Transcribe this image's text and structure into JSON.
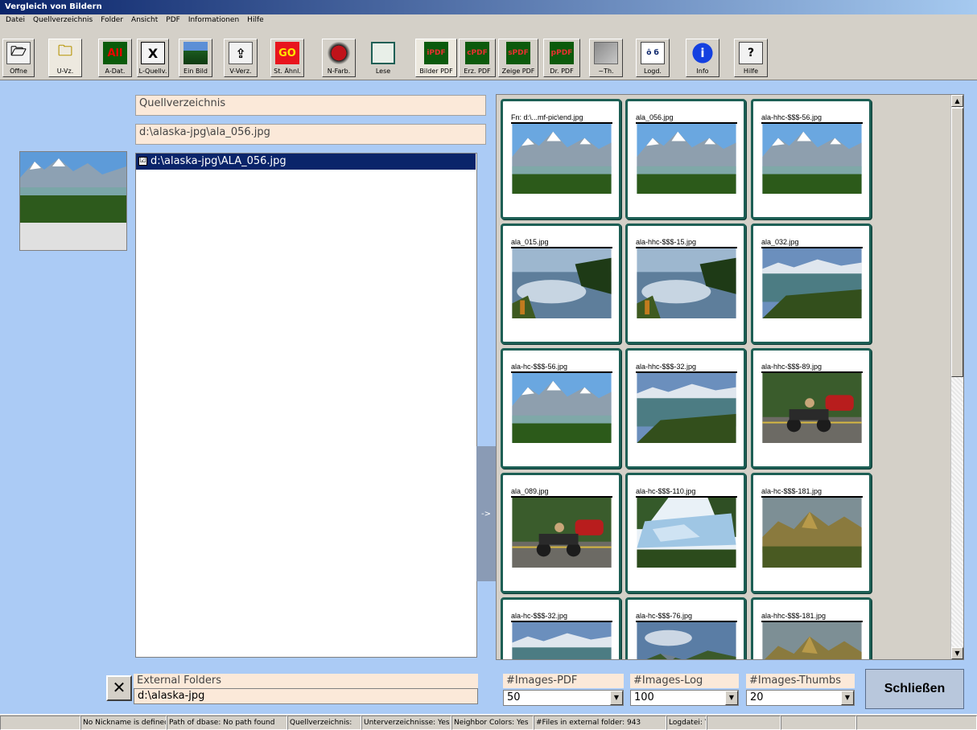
{
  "window": {
    "title": "Vergleich von Bildern"
  },
  "menu": [
    "Datei",
    "Quellverzeichnis",
    "Folder",
    "Ansicht",
    "PDF",
    "Informationen",
    "Hilfe"
  ],
  "toolbar": [
    {
      "label": "Öffne",
      "icon": "open-folder-icon",
      "glyph": "🗁"
    },
    {
      "label": "U-Vz.",
      "icon": "folder-icon",
      "glyph": "🗀"
    },
    {
      "label": "A-Dat.",
      "icon": "all-files-icon",
      "glyph": "All"
    },
    {
      "label": "L-Quellv.",
      "icon": "delete-source-icon",
      "glyph": "X"
    },
    {
      "label": "Ein Bild",
      "icon": "single-image-icon",
      "glyph": ""
    },
    {
      "label": "V-Verz.",
      "icon": "compare-folder-icon",
      "glyph": "⇪"
    },
    {
      "label": "St. Ähnl.",
      "icon": "go-icon",
      "glyph": "GO"
    },
    {
      "label": "N-Farb.",
      "icon": "neighbor-colors-icon",
      "glyph": ""
    },
    {
      "label": "Lese",
      "icon": "read-icon",
      "glyph": ""
    },
    {
      "label": "Bilder PDF",
      "icon": "images-pdf-icon",
      "glyph": "iPDF"
    },
    {
      "label": "Erz. PDF",
      "icon": "create-pdf-icon",
      "glyph": "cPDF"
    },
    {
      "label": "Zeige PDF",
      "icon": "show-pdf-icon",
      "glyph": "sPDF"
    },
    {
      "label": "Dr. PDF",
      "icon": "print-pdf-icon",
      "glyph": "pPDF"
    },
    {
      "label": "~Th.",
      "icon": "thumbnails-icon",
      "glyph": ""
    },
    {
      "label": "Logd.",
      "icon": "logfile-icon",
      "glyph": "ô б"
    },
    {
      "label": "Info",
      "icon": "info-icon",
      "glyph": "i"
    },
    {
      "label": "Hilfe",
      "icon": "help-icon",
      "glyph": "?"
    }
  ],
  "source": {
    "label": "Quellverzeichnis",
    "path": "d:\\alaska-jpg\\ala_056.jpg",
    "selected_item": "d:\\alaska-jpg\\ALA_056.jpg",
    "checked": "☑"
  },
  "toggle_label": "->",
  "thumbnails": [
    {
      "caption": "Fn: d:\\...mf-pic\\end.jpg",
      "scene": "mountain"
    },
    {
      "caption": "ala_056.jpg",
      "scene": "mountain"
    },
    {
      "caption": "ala-hhc-$$$-56.jpg",
      "scene": "mountain"
    },
    {
      "caption": "ala_015.jpg",
      "scene": "lake"
    },
    {
      "caption": "ala-hhc-$$$-15.jpg",
      "scene": "lake"
    },
    {
      "caption": "ala_032.jpg",
      "scene": "bay"
    },
    {
      "caption": "ala-hc-$$$-56.jpg",
      "scene": "mountain"
    },
    {
      "caption": "ala-hhc-$$$-32.jpg",
      "scene": "bay"
    },
    {
      "caption": "ala-hhc-$$$-89.jpg",
      "scene": "road"
    },
    {
      "caption": "ala_089.jpg",
      "scene": "road"
    },
    {
      "caption": "ala-hc-$$$-110.jpg",
      "scene": "glacier"
    },
    {
      "caption": "ala-hc-$$$-181.jpg",
      "scene": "hills"
    },
    {
      "caption": "ala-hc-$$$-32.jpg",
      "scene": "bay"
    },
    {
      "caption": "ala-hc-$$$-76.jpg",
      "scene": "valley"
    },
    {
      "caption": "ala-hhc-$$$-181.jpg",
      "scene": "hills"
    }
  ],
  "external": {
    "label": "External Folders",
    "path": "d:\\alaska-jpg"
  },
  "combos": [
    {
      "label": "#Images-PDF",
      "value": "50"
    },
    {
      "label": "#Images-Log",
      "value": "100"
    },
    {
      "label": "#Images-Thumbs",
      "value": "20"
    }
  ],
  "close_label": "Schließen",
  "status": [
    "",
    "No Nickname is defined",
    "Path of dbase: No path found",
    "Quellverzeichnis:",
    "Unterverzeichnisse: Yes",
    "Neighbor Colors: Yes",
    "#Files in external folder: 943",
    "Logdatei: Yes",
    "",
    "",
    ""
  ]
}
